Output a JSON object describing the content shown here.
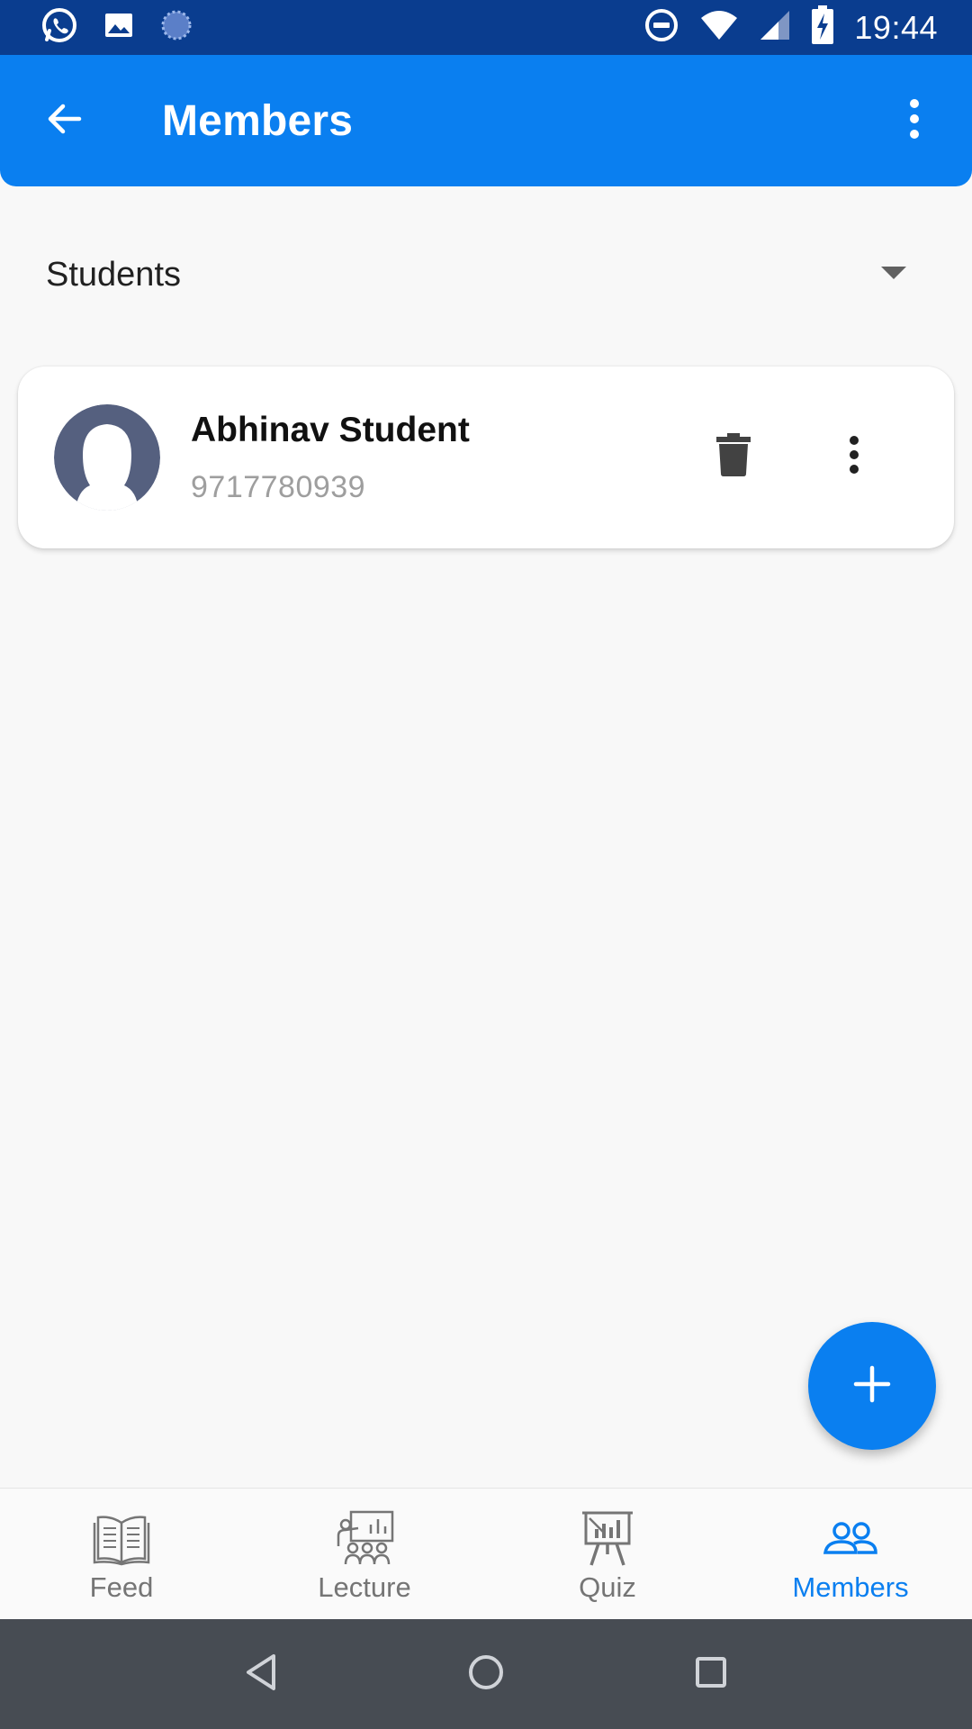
{
  "status_bar": {
    "time": "19:44",
    "icons": [
      "whatsapp-icon",
      "image-icon",
      "sync-icon",
      "do-not-disturb-icon",
      "wifi-icon",
      "signal-icon",
      "battery-charging-icon"
    ]
  },
  "app_bar": {
    "title": "Members",
    "back_icon": "arrow-left-icon",
    "overflow_icon": "more-vert-icon"
  },
  "filter": {
    "selected": "Students",
    "arrow_icon": "dropdown-arrow-icon"
  },
  "members": [
    {
      "name": "Abhinav Student",
      "phone": "9717780939",
      "avatar_icon": "default-avatar-icon",
      "delete_icon": "trash-icon",
      "menu_icon": "more-vert-icon"
    }
  ],
  "fab": {
    "icon": "plus-icon"
  },
  "bottom_nav": {
    "items": [
      {
        "label": "Feed",
        "icon": "book-icon",
        "active": false
      },
      {
        "label": "Lecture",
        "icon": "classroom-icon",
        "active": false
      },
      {
        "label": "Quiz",
        "icon": "presentation-chart-icon",
        "active": false
      },
      {
        "label": "Members",
        "icon": "people-icon",
        "active": true
      }
    ]
  },
  "system_nav": {
    "icons": [
      "back-triangle-icon",
      "home-circle-icon",
      "recents-square-icon"
    ]
  },
  "colors": {
    "status_bar": "#0a3d8f",
    "primary": "#0a7ff0",
    "background": "#f8f8f8",
    "system_nav": "#474c53",
    "inactive_nav": "#757575"
  }
}
